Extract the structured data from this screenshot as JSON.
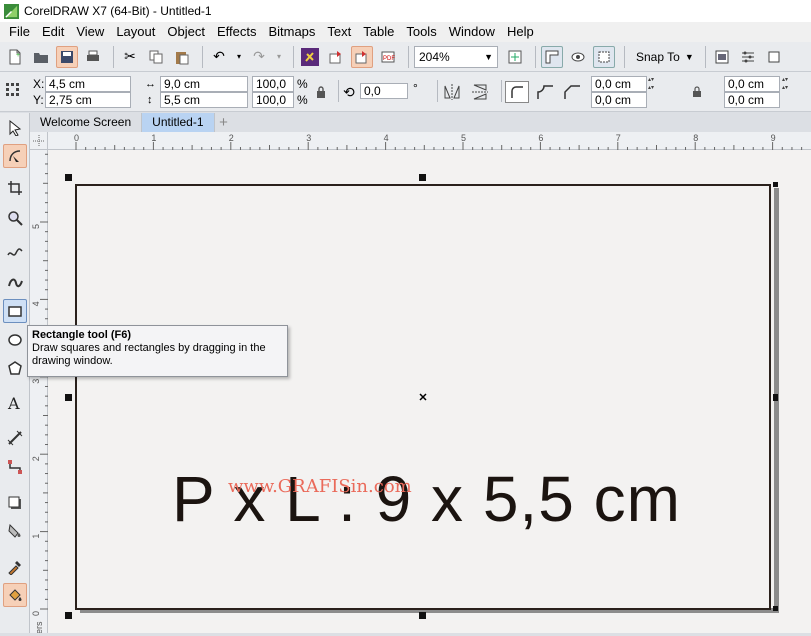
{
  "window": {
    "title": "CorelDRAW X7 (64-Bit) - Untitled-1"
  },
  "menu": [
    "File",
    "Edit",
    "View",
    "Layout",
    "Object",
    "Effects",
    "Bitmaps",
    "Text",
    "Table",
    "Tools",
    "Window",
    "Help"
  ],
  "toolbar": {
    "zoom_value": "204%",
    "snap_label": "Snap To"
  },
  "properties": {
    "x_label": "X:",
    "x_value": "4,5 cm",
    "y_label": "Y:",
    "y_value": "2,75 cm",
    "width_value": "9,0 cm",
    "height_value": "5,5 cm",
    "scale_w": "100,0",
    "scale_h": "100,0",
    "percent_1": "%",
    "percent_2": "%",
    "rotation_value": "0,0",
    "degree": "°",
    "corner_1": "0,0 cm",
    "corner_2": "0,0 cm",
    "corner_3": "0,0 cm",
    "corner_4": "0,0 cm"
  },
  "tabs": [
    "Welcome Screen",
    "Untitled-1"
  ],
  "ruler": {
    "h_labels": [
      "0",
      "1",
      "2",
      "3",
      "4",
      "5",
      "6",
      "7",
      "8",
      "9"
    ],
    "v_labels": [
      "5",
      "4",
      "3",
      "2",
      "1",
      "0"
    ],
    "v_caption": "ers"
  },
  "tooltip": {
    "title": "Rectangle tool (F6)",
    "body": "Draw squares and rectangles by dragging in the drawing window."
  },
  "canvas": {
    "watermark": "www.GRAFISin.com",
    "main_text": "P x L : 9 x 5,5 cm"
  }
}
